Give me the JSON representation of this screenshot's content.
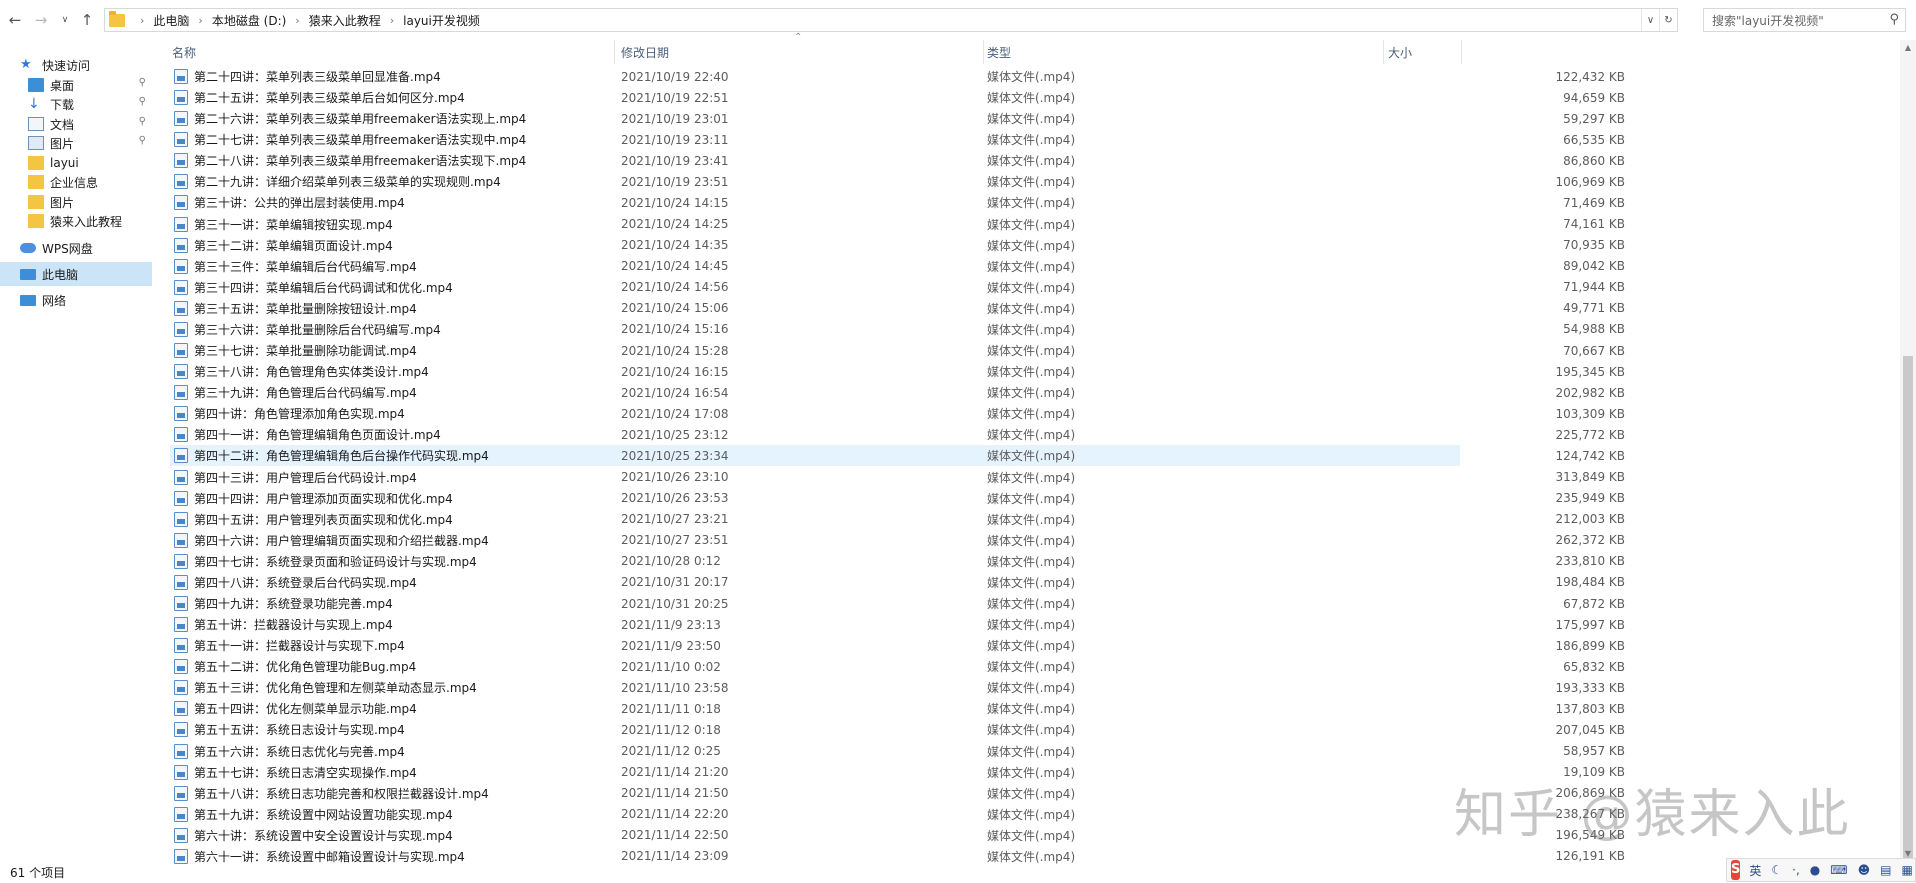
{
  "address": {
    "crumbs": [
      "此电脑",
      "本地磁盘 (D:)",
      "猿来入此教程",
      "layui开发视频"
    ]
  },
  "search": {
    "placeholder": "搜索\"layui开发视频\""
  },
  "sidebar": {
    "items": [
      {
        "label": "快速访问",
        "icon": "star-icon"
      },
      {
        "label": "桌面",
        "icon": "desktop-icon",
        "pinned": true
      },
      {
        "label": "下载",
        "icon": "download-icon",
        "pinned": true
      },
      {
        "label": "文档",
        "icon": "document-icon",
        "pinned": true
      },
      {
        "label": "图片",
        "icon": "picture-icon",
        "pinned": true
      },
      {
        "label": "layui",
        "icon": "folder-icon"
      },
      {
        "label": "企业信息",
        "icon": "folder-icon"
      },
      {
        "label": "图片",
        "icon": "folder-icon"
      },
      {
        "label": "猿来入此教程",
        "icon": "folder-icon"
      },
      {
        "label": "WPS网盘",
        "icon": "cloud-icon"
      },
      {
        "label": "此电脑",
        "icon": "computer-icon",
        "selected": true
      },
      {
        "label": "网络",
        "icon": "network-icon"
      }
    ]
  },
  "columns": {
    "name": "名称",
    "date": "修改日期",
    "type": "类型",
    "size": "大小"
  },
  "files": [
    {
      "name": "第二十四讲：菜单列表三级菜单回显准备.mp4",
      "date": "2021/10/19 22:40",
      "type": "媒体文件(.mp4)",
      "size": "122,432 KB"
    },
    {
      "name": "第二十五讲：菜单列表三级菜单后台如何区分.mp4",
      "date": "2021/10/19 22:51",
      "type": "媒体文件(.mp4)",
      "size": "94,659 KB"
    },
    {
      "name": "第二十六讲：菜单列表三级菜单用freemaker语法实现上.mp4",
      "date": "2021/10/19 23:01",
      "type": "媒体文件(.mp4)",
      "size": "59,297 KB"
    },
    {
      "name": "第二十七讲：菜单列表三级菜单用freemaker语法实现中.mp4",
      "date": "2021/10/19 23:11",
      "type": "媒体文件(.mp4)",
      "size": "66,535 KB"
    },
    {
      "name": "第二十八讲：菜单列表三级菜单用freemaker语法实现下.mp4",
      "date": "2021/10/19 23:41",
      "type": "媒体文件(.mp4)",
      "size": "86,860 KB"
    },
    {
      "name": "第二十九讲：详细介绍菜单列表三级菜单的实现规则.mp4",
      "date": "2021/10/19 23:51",
      "type": "媒体文件(.mp4)",
      "size": "106,969 KB"
    },
    {
      "name": "第三十讲：公共的弹出层封装使用.mp4",
      "date": "2021/10/24 14:15",
      "type": "媒体文件(.mp4)",
      "size": "71,469 KB"
    },
    {
      "name": "第三十一讲：菜单编辑按钮实现.mp4",
      "date": "2021/10/24 14:25",
      "type": "媒体文件(.mp4)",
      "size": "74,161 KB"
    },
    {
      "name": "第三十二讲：菜单编辑页面设计.mp4",
      "date": "2021/10/24 14:35",
      "type": "媒体文件(.mp4)",
      "size": "70,935 KB"
    },
    {
      "name": "第三十三件：菜单编辑后台代码编写.mp4",
      "date": "2021/10/24 14:45",
      "type": "媒体文件(.mp4)",
      "size": "89,042 KB"
    },
    {
      "name": "第三十四讲：菜单编辑后台代码调试和优化.mp4",
      "date": "2021/10/24 14:56",
      "type": "媒体文件(.mp4)",
      "size": "71,944 KB"
    },
    {
      "name": "第三十五讲：菜单批量删除按钮设计.mp4",
      "date": "2021/10/24 15:06",
      "type": "媒体文件(.mp4)",
      "size": "49,771 KB"
    },
    {
      "name": "第三十六讲：菜单批量删除后台代码编写.mp4",
      "date": "2021/10/24 15:16",
      "type": "媒体文件(.mp4)",
      "size": "54,988 KB"
    },
    {
      "name": "第三十七讲：菜单批量删除功能调试.mp4",
      "date": "2021/10/24 15:28",
      "type": "媒体文件(.mp4)",
      "size": "70,667 KB"
    },
    {
      "name": "第三十八讲：角色管理角色实体类设计.mp4",
      "date": "2021/10/24 16:15",
      "type": "媒体文件(.mp4)",
      "size": "195,345 KB"
    },
    {
      "name": "第三十九讲：角色管理后台代码编写.mp4",
      "date": "2021/10/24 16:54",
      "type": "媒体文件(.mp4)",
      "size": "202,982 KB"
    },
    {
      "name": "第四十讲：角色管理添加角色实现.mp4",
      "date": "2021/10/24 17:08",
      "type": "媒体文件(.mp4)",
      "size": "103,309 KB"
    },
    {
      "name": "第四十一讲：角色管理编辑角色页面设计.mp4",
      "date": "2021/10/25 23:12",
      "type": "媒体文件(.mp4)",
      "size": "225,772 KB"
    },
    {
      "name": "第四十二讲：角色管理编辑角色后台操作代码实现.mp4",
      "date": "2021/10/25 23:34",
      "type": "媒体文件(.mp4)",
      "size": "124,742 KB",
      "selected": true
    },
    {
      "name": "第四十三讲：用户管理后台代码设计.mp4",
      "date": "2021/10/26 23:10",
      "type": "媒体文件(.mp4)",
      "size": "313,849 KB"
    },
    {
      "name": "第四十四讲：用户管理添加页面实现和优化.mp4",
      "date": "2021/10/26 23:53",
      "type": "媒体文件(.mp4)",
      "size": "235,949 KB"
    },
    {
      "name": "第四十五讲：用户管理列表页面实现和优化.mp4",
      "date": "2021/10/27 23:21",
      "type": "媒体文件(.mp4)",
      "size": "212,003 KB"
    },
    {
      "name": "第四十六讲：用户管理编辑页面实现和介绍拦截器.mp4",
      "date": "2021/10/27 23:51",
      "type": "媒体文件(.mp4)",
      "size": "262,372 KB"
    },
    {
      "name": "第四十七讲：系统登录页面和验证码设计与实现.mp4",
      "date": "2021/10/28 0:12",
      "type": "媒体文件(.mp4)",
      "size": "233,810 KB"
    },
    {
      "name": "第四十八讲：系统登录后台代码实现.mp4",
      "date": "2021/10/31 20:17",
      "type": "媒体文件(.mp4)",
      "size": "198,484 KB"
    },
    {
      "name": "第四十九讲：系统登录功能完善.mp4",
      "date": "2021/10/31 20:25",
      "type": "媒体文件(.mp4)",
      "size": "67,872 KB"
    },
    {
      "name": "第五十讲：拦截器设计与实现上.mp4",
      "date": "2021/11/9 23:13",
      "type": "媒体文件(.mp4)",
      "size": "175,997 KB"
    },
    {
      "name": "第五十一讲：拦截器设计与实现下.mp4",
      "date": "2021/11/9 23:50",
      "type": "媒体文件(.mp4)",
      "size": "186,899 KB"
    },
    {
      "name": "第五十二讲：优化角色管理功能Bug.mp4",
      "date": "2021/11/10 0:02",
      "type": "媒体文件(.mp4)",
      "size": "65,832 KB"
    },
    {
      "name": "第五十三讲：优化角色管理和左侧菜单动态显示.mp4",
      "date": "2021/11/10 23:58",
      "type": "媒体文件(.mp4)",
      "size": "193,333 KB"
    },
    {
      "name": "第五十四讲：优化左侧菜单显示功能.mp4",
      "date": "2021/11/11 0:18",
      "type": "媒体文件(.mp4)",
      "size": "137,803 KB"
    },
    {
      "name": "第五十五讲：系统日志设计与实现.mp4",
      "date": "2021/11/12 0:18",
      "type": "媒体文件(.mp4)",
      "size": "207,045 KB"
    },
    {
      "name": "第五十六讲：系统日志优化与完善.mp4",
      "date": "2021/11/12 0:25",
      "type": "媒体文件(.mp4)",
      "size": "58,957 KB"
    },
    {
      "name": "第五十七讲：系统日志清空实现操作.mp4",
      "date": "2021/11/14 21:20",
      "type": "媒体文件(.mp4)",
      "size": "19,109 KB"
    },
    {
      "name": "第五十八讲：系统日志功能完善和权限拦截器设计.mp4",
      "date": "2021/11/14 21:50",
      "type": "媒体文件(.mp4)",
      "size": "206,869 KB"
    },
    {
      "name": "第五十九讲：系统设置中网站设置功能实现.mp4",
      "date": "2021/11/14 22:20",
      "type": "媒体文件(.mp4)",
      "size": "238,267 KB"
    },
    {
      "name": "第六十讲：系统设置中安全设置设计与实现.mp4",
      "date": "2021/11/14 22:50",
      "type": "媒体文件(.mp4)",
      "size": "196,549 KB"
    },
    {
      "name": "第六十一讲：系统设置中邮箱设置设计与实现.mp4",
      "date": "2021/11/14 23:09",
      "type": "媒体文件(.mp4)",
      "size": "126,191 KB"
    }
  ],
  "status": {
    "item_count": "61 个项目"
  },
  "watermark": {
    "text": "知乎 @猿来入此"
  },
  "ime": {
    "logo": "S",
    "mode": "英"
  },
  "colors": {
    "selected_row": "#e5f3ff",
    "sidebar_selected": "#cce4f7",
    "header_text": "#4c607a"
  }
}
